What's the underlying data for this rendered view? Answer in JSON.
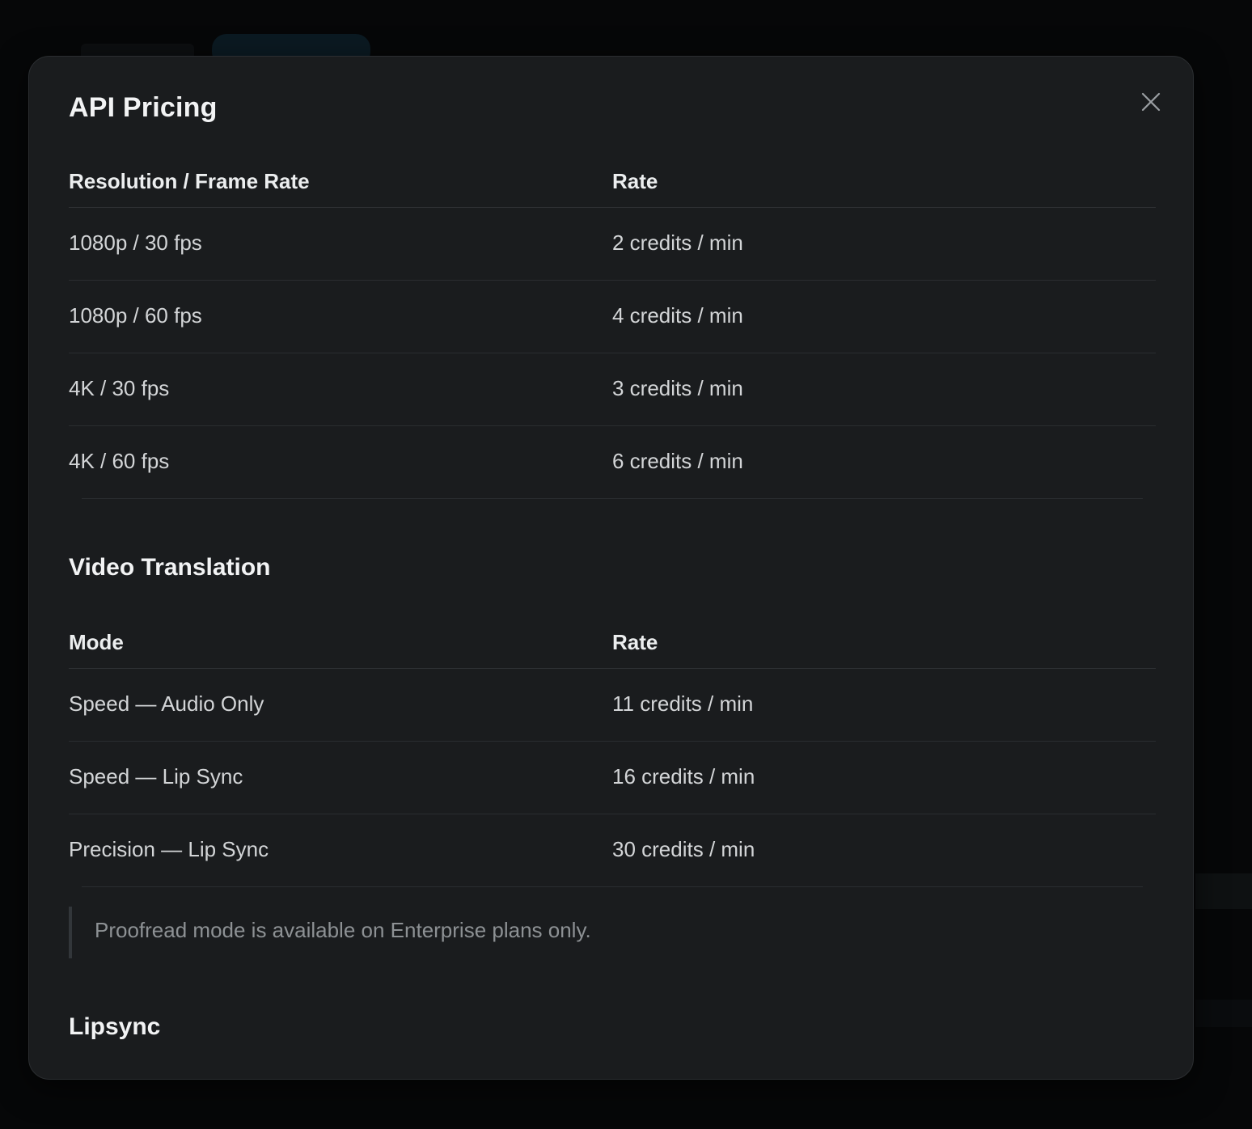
{
  "modal": {
    "title": "API Pricing",
    "close_label": "Close"
  },
  "avatar_pricing": {
    "columns": [
      "Resolution / Frame Rate",
      "Rate"
    ],
    "rows": [
      [
        "1080p / 30 fps",
        "2 credits / min"
      ],
      [
        "1080p / 60 fps",
        "4 credits / min"
      ],
      [
        "4K / 30 fps",
        "3 credits / min"
      ],
      [
        "4K / 60 fps",
        "6 credits / min"
      ]
    ]
  },
  "video_translation": {
    "title": "Video Translation",
    "columns": [
      "Mode",
      "Rate"
    ],
    "rows": [
      [
        "Speed — Audio Only",
        "11 credits / min"
      ],
      [
        "Speed — Lip Sync",
        "16 credits / min"
      ],
      [
        "Precision — Lip Sync",
        "30 credits / min"
      ]
    ],
    "note": "Proofread mode is available on Enterprise plans only."
  },
  "lipsync": {
    "title": "Lipsync"
  },
  "icons": {
    "close": "close-icon"
  },
  "colors": {
    "modal_bg": "#1a1c1e",
    "page_bg": "#060708",
    "divider": "#2a2d30",
    "heading_text": "#f2f3f4",
    "body_text": "#d3d5d7",
    "muted_text": "#8d9194"
  }
}
